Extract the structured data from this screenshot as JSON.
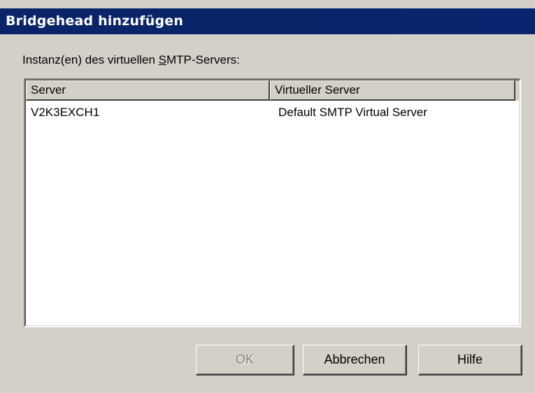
{
  "window": {
    "title": "Bridgehead hinzufügen"
  },
  "instance_label": {
    "before": "Instanz(en) des virtuellen ",
    "mnemonic": "S",
    "after": "MTP-Servers:"
  },
  "list": {
    "columns": [
      "Server",
      "Virtueller Server"
    ],
    "rows": [
      {
        "server": "V2K3EXCH1",
        "virtual_server": "Default SMTP Virtual Server"
      }
    ]
  },
  "buttons": {
    "ok": {
      "label": "OK",
      "enabled": false
    },
    "cancel": {
      "label": "Abbrechen",
      "enabled": true
    },
    "help": {
      "label": "Hilfe",
      "enabled": true
    }
  },
  "colors": {
    "titlebar": "#0a246a",
    "face": "#d4d0c8",
    "disabled_text": "#808080"
  }
}
